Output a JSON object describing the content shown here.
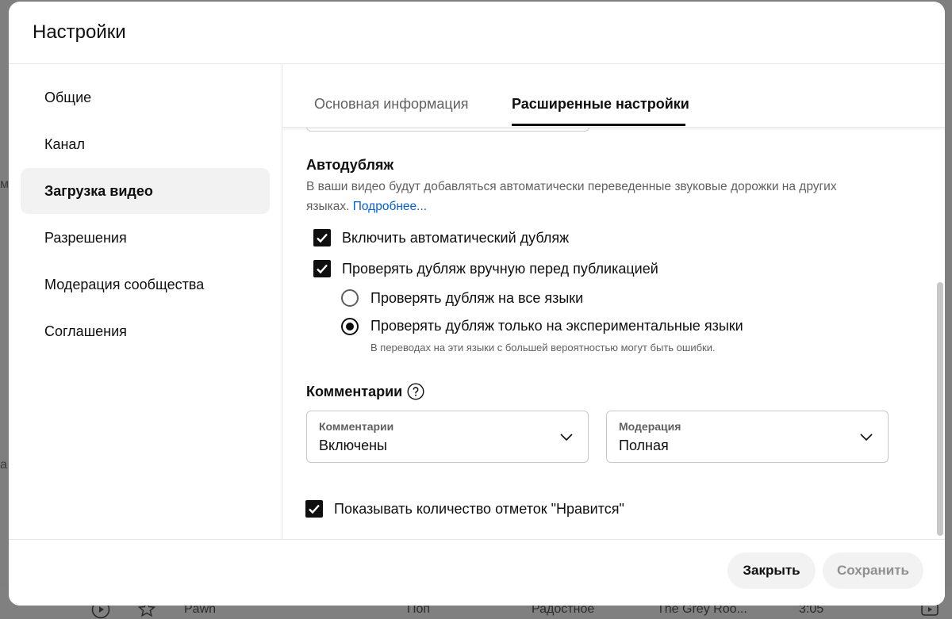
{
  "background": {
    "fragment_left_1": "ми",
    "fragment_left_2": "а",
    "row": {
      "title": "Pawn",
      "genre": "Поп",
      "mood": "Радостное",
      "artist": "The Grey Roo...",
      "duration": "3:05"
    }
  },
  "dialog": {
    "title": "Настройки",
    "sidebar": {
      "items": [
        {
          "label": "Общие"
        },
        {
          "label": "Канал"
        },
        {
          "label": "Загрузка видео"
        },
        {
          "label": "Разрешения"
        },
        {
          "label": "Модерация сообщества"
        },
        {
          "label": "Соглашения"
        }
      ],
      "active_index": 2
    },
    "tabs": [
      {
        "label": "Основная информация"
      },
      {
        "label": "Расширенные настройки"
      }
    ],
    "active_tab_index": 1,
    "autodub": {
      "title": "Автодубляж",
      "description": "В ваши видео будут добавляться автоматически переведенные звуковые дорожки на других языках.",
      "link": "Подробнее...",
      "enable_checkbox": {
        "label": "Включить автоматический дубляж",
        "checked": true
      },
      "review_checkbox": {
        "label": "Проверять дубляж вручную перед публикацией",
        "checked": true
      },
      "radio_all": {
        "label": "Проверять дубляж на все языки",
        "checked": false
      },
      "radio_experimental": {
        "label": "Проверять дубляж только на экспериментальные языки",
        "checked": true
      },
      "experimental_hint": "В переводах на эти языки с большей вероятностью могут быть ошибки."
    },
    "comments": {
      "title": "Комментарии",
      "comments_select": {
        "label": "Комментарии",
        "value": "Включены"
      },
      "moderation_select": {
        "label": "Модерация",
        "value": "Полная"
      }
    },
    "likes_checkbox": {
      "label": "Показывать количество отметок \"Нравится\"",
      "checked": true
    },
    "footer": {
      "close_label": "Закрыть",
      "save_label": "Сохранить"
    }
  },
  "colors": {
    "overlay": "#7f7f7f",
    "text_primary": "#0f0f0f",
    "text_secondary": "#606060",
    "link": "#065fd4",
    "button_bg": "#f2f2f2",
    "disabled_text": "#909090"
  }
}
